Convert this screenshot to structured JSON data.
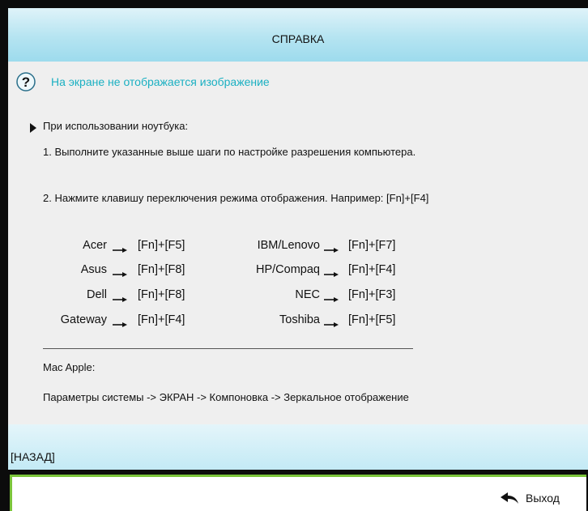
{
  "title": "СПРАВКА",
  "heading": {
    "icon": "help-question-icon",
    "text": "На экране не отображается изображение",
    "color": "#1bb0c2"
  },
  "section": {
    "bullet_text": "При использовании ноутбука:",
    "step1": "1. Выполните указанные выше шаги по настройке разрешения компьютера.",
    "step2": "2. Нажмите клавишу переключения режима отображения. Например: [Fn]+[F4]"
  },
  "shortcuts": {
    "left": [
      {
        "brand": "Acer",
        "keys": "[Fn]+[F5]"
      },
      {
        "brand": "Asus",
        "keys": "[Fn]+[F8]"
      },
      {
        "brand": "Dell",
        "keys": "[Fn]+[F8]"
      },
      {
        "brand": "Gateway",
        "keys": "[Fn]+[F4]"
      }
    ],
    "right": [
      {
        "brand": "IBM/Lenovo",
        "keys": "[Fn]+[F7]"
      },
      {
        "brand": "HP/Compaq",
        "keys": "[Fn]+[F4]"
      },
      {
        "brand": "NEC",
        "keys": "[Fn]+[F3]"
      },
      {
        "brand": "Toshiba",
        "keys": "[Fn]+[F5]"
      }
    ]
  },
  "mac": {
    "label": "Mac Apple:",
    "path": "Параметры системы -> ЭКРАН -> Компоновка -> Зеркальное отображение"
  },
  "back_label": "[НАЗАД]",
  "exit": {
    "icon": "return-arrow-icon",
    "label": "Выход"
  },
  "colors": {
    "title_bar": "#b5e4f1",
    "footer_border": "#7bc43a"
  }
}
